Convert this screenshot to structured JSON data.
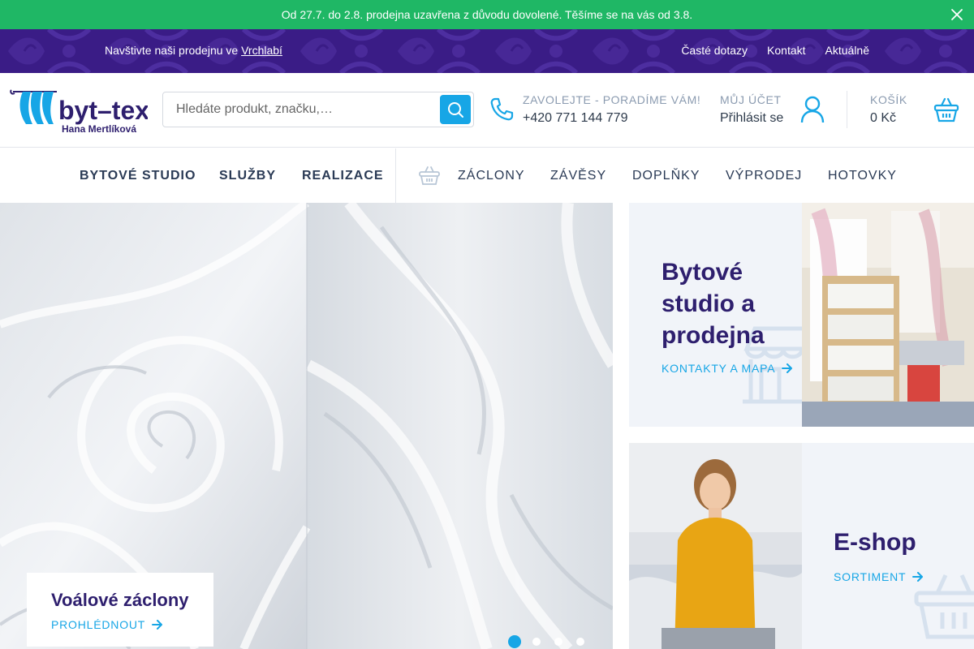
{
  "notice": {
    "text": "Od 27.7. do 2.8. prodejna uzavřena z důvodu dovolené. Těšíme se na vás od 3.8.",
    "close_icon": "close-icon"
  },
  "topbar": {
    "visit_prefix": "Navštivte naši prodejnu ve",
    "visit_link": "Vrchlabí",
    "links": [
      "Časté dotazy",
      "Kontakt",
      "Aktuálně"
    ]
  },
  "logo": {
    "name": "byt-tex",
    "owner": "Hana Mertlíková"
  },
  "search": {
    "placeholder": "Hledáte produkt, značku,…",
    "value": ""
  },
  "contact": {
    "label": "ZAVOLEJTE - PORADÍME VÁM!",
    "phone": "+420 771 144 779"
  },
  "account": {
    "label": "MŮJ ÚČET",
    "login": "Přihlásit se"
  },
  "cart": {
    "label": "KOŠÍK",
    "total": "0 Kč"
  },
  "nav": {
    "left": [
      "BYTOVÉ STUDIO",
      "SLUŽBY",
      "REALIZACE"
    ],
    "right": [
      "ZÁCLONY",
      "ZÁVĚSY",
      "DOPLŇKY",
      "VÝPRODEJ",
      "HOTOVKY"
    ]
  },
  "hero": {
    "title": "Voálové záclony",
    "cta": "PROHLÉDNOUT",
    "slide_count": 4,
    "active_slide": 1
  },
  "promo_studio": {
    "title": "Bytové studio a prodejna",
    "cta": "KONTAKTY A MAPA"
  },
  "promo_eshop": {
    "title": "E-shop",
    "cta": "SORTIMENT"
  },
  "colors": {
    "notice_bg": "#1fb765",
    "topbar_bg": "#3a1c86",
    "accent": "#17a6e6",
    "heading": "#2e1f6e"
  }
}
